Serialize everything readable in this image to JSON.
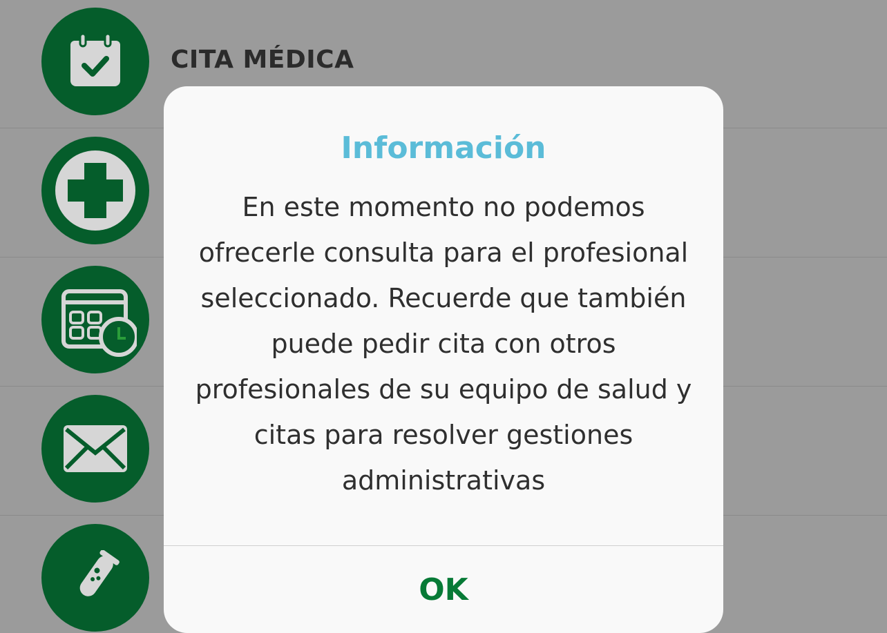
{
  "menu": {
    "items": [
      {
        "icon": "calendar-check-icon",
        "label": "CITA MÉDICA"
      },
      {
        "icon": "medical-cross-icon",
        "label": ""
      },
      {
        "icon": "calendar-clock-icon",
        "label": ""
      },
      {
        "icon": "envelope-icon",
        "label": ""
      },
      {
        "icon": "test-tube-icon",
        "label": ""
      }
    ]
  },
  "dialog": {
    "title": "Información",
    "message": "En este momento no podemos ofrecerle consulta para el profesional seleccionado. Recuerde que también puede pedir cita con otros profesionales de su equipo de salud y citas para resolver gestiones administrativas",
    "ok_label": "OK"
  },
  "colors": {
    "overlay_background": "#9b9b9b",
    "icon_circle": "#055d2b",
    "dialog_title": "#5bbcd8",
    "ok_button": "#077a36"
  }
}
